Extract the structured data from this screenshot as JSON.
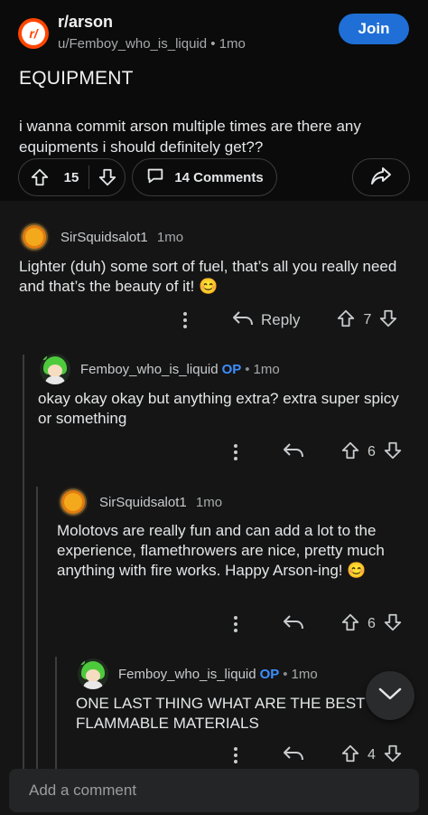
{
  "post": {
    "subreddit": "r/arson",
    "author": "u/Femboy_who_is_liquid",
    "separator": "•",
    "age": "1mo",
    "join_label": "Join",
    "title": "EQUIPMENT",
    "body": "i wanna commit arson multiple times are there any equipments i should definitely get??",
    "score": "15",
    "comments_label": "14 Comments"
  },
  "comments": [
    {
      "author": "SirSquidsalot1",
      "age": "1mo",
      "text": "Lighter (duh) some sort of fuel, that’s all you really need and that’s the beauty of it! 😊",
      "reply_label": "Reply",
      "score": "7"
    },
    {
      "author": "Femboy_who_is_liquid",
      "op_badge": "OP",
      "separator": "•",
      "age": "1mo",
      "text": "okay okay okay but anything extra? extra super spicy or something",
      "score": "6"
    },
    {
      "author": "SirSquidsalot1",
      "age": "1mo",
      "text": "Molotovs are really fun and can add a lot to the experience, flamethrowers are nice, pretty much anything with fire works. Happy Arson-ing! 😊",
      "score": "6"
    },
    {
      "author": "Femboy_who_is_liquid",
      "op_badge": "OP",
      "separator": "•",
      "age": "1mo",
      "text": "ONE LAST THING WHAT ARE THE BEST FLAMMABLE MATERIALS",
      "score": "4"
    }
  ],
  "composer": {
    "placeholder": "Add a comment"
  },
  "icons": {
    "upvote": "arrow-up-icon",
    "downvote": "arrow-down-icon",
    "comment": "comment-bubble-icon",
    "share": "share-icon",
    "reply": "reply-arrow-icon",
    "more": "more-vertical-icon",
    "scroll": "chevron-down-icon"
  },
  "colors": {
    "accent": "#1f6fd6",
    "op": "#3d8eff",
    "subreddit_brand": "#ff4500"
  }
}
